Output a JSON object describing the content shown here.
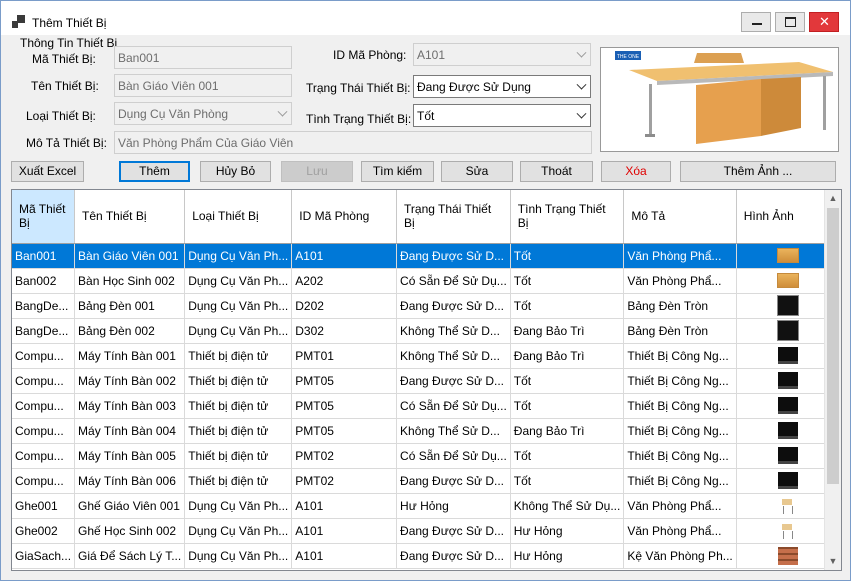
{
  "window": {
    "title": "Thêm Thiết Bị",
    "minimize": "—",
    "maximize": "▢",
    "close": "✕"
  },
  "form": {
    "group_title": "Thông Tin Thiết Bị",
    "ma_thiet_bi": {
      "label": "Mã Thiết Bị:",
      "value": "Ban001"
    },
    "ten_thiet_bi": {
      "label": "Tên Thiết Bị:",
      "value": "Bàn Giáo Viên 001"
    },
    "loai_thiet_bi": {
      "label": "Loại Thiết Bị:",
      "value": "Dụng Cụ Văn Phòng"
    },
    "mo_ta": {
      "label": "Mô Tả Thiết Bị:",
      "value": "Văn Phòng Phẩm Của Giáo Viên"
    },
    "id_phong": {
      "label": "ID Mã Phòng:",
      "value": "A101"
    },
    "trang_thai": {
      "label": "Trạng Thái Thiết Bị:",
      "value": "Đang Được Sử Dụng"
    },
    "tinh_trang": {
      "label": "Tình Trạng Thiết Bị:",
      "value": "Tốt"
    },
    "picture_logo": "THE ONE"
  },
  "buttons": {
    "export": "Xuất Excel",
    "add": "Thêm",
    "cancel": "Hủy Bỏ",
    "save": "Lưu",
    "search": "Tìm kiếm",
    "edit": "Sửa",
    "exit": "Thoát",
    "delete": "Xóa",
    "add_image": "Thêm Ảnh ..."
  },
  "grid": {
    "headers": [
      "Mã Thiết Bị",
      "Tên Thiết Bị",
      "Loại Thiết Bị",
      "ID Mã Phòng",
      "Trạng Thái Thiết Bị",
      "Tình Trạng Thiết Bị",
      "Mô Tả",
      "Hình Ảnh"
    ],
    "rows": [
      {
        "c": [
          "Ban001",
          "Bàn Giáo Viên 001",
          "Dụng Cụ Văn Ph...",
          "A101",
          "Đang Được Sử D...",
          "Tốt",
          "Văn Phòng Phẩ..."
        ],
        "img": "desk-image"
      },
      {
        "c": [
          "Ban002",
          "Bàn Học Sinh 002",
          "Dụng Cụ Văn Ph...",
          "A202",
          "Có Sẵn Để Sử Dụ...",
          "Tốt",
          "Văn Phòng Phẩ..."
        ],
        "img": "desk-image"
      },
      {
        "c": [
          "BangDe...",
          "Bảng Đèn 001",
          "Dụng Cụ Văn Ph...",
          "D202",
          "Đang Được Sử D...",
          "Tốt",
          "Bảng Đèn Tròn"
        ],
        "img": "light-board-image"
      },
      {
        "c": [
          "BangDe...",
          "Bảng Đèn 002",
          "Dụng Cụ Văn Ph...",
          "D302",
          "Không Thể Sử D...",
          "Đang Bảo Trì",
          "Bảng Đèn Tròn"
        ],
        "img": "light-board-image"
      },
      {
        "c": [
          "Compu...",
          "Máy Tính Bàn 001",
          "Thiết bị điện tử",
          "PMT01",
          "Không Thể Sử D...",
          "Đang Bảo Trì",
          "Thiết Bị Công Ng..."
        ],
        "img": "computer-image"
      },
      {
        "c": [
          "Compu...",
          "Máy Tính Bàn 002",
          "Thiết bị điện tử",
          "PMT05",
          "Đang Được Sử D...",
          "Tốt",
          "Thiết Bị Công Ng..."
        ],
        "img": "computer-image"
      },
      {
        "c": [
          "Compu...",
          "Máy Tính Bàn 003",
          "Thiết bị điện tử",
          "PMT05",
          "Có Sẵn Để Sử Dụ...",
          "Tốt",
          "Thiết Bị Công Ng..."
        ],
        "img": "computer-image"
      },
      {
        "c": [
          "Compu...",
          "Máy Tính Bàn 004",
          "Thiết bị điện tử",
          "PMT05",
          "Không Thể Sử D...",
          "Đang Bảo Trì",
          "Thiết Bị Công Ng..."
        ],
        "img": "computer-image"
      },
      {
        "c": [
          "Compu...",
          "Máy Tính Bàn 005",
          "Thiết bị điện tử",
          "PMT02",
          "Có Sẵn Để Sử Dụ...",
          "Tốt",
          "Thiết Bị Công Ng..."
        ],
        "img": "computer-image"
      },
      {
        "c": [
          "Compu...",
          "Máy Tính Bàn 006",
          "Thiết bị điện tử",
          "PMT02",
          "Đang Được Sử D...",
          "Tốt",
          "Thiết Bị Công Ng..."
        ],
        "img": "computer-image"
      },
      {
        "c": [
          "Ghe001",
          "Ghế Giáo Viên 001",
          "Dụng Cụ Văn Ph...",
          "A101",
          "Hư Hỏng",
          "Không Thể Sử Dụ...",
          "Văn Phòng Phẩ..."
        ],
        "img": "chair-image"
      },
      {
        "c": [
          "Ghe002",
          "Ghế Học Sinh 002",
          "Dụng Cụ Văn Ph...",
          "A101",
          "Đang Được Sử D...",
          "Hư Hỏng",
          "Văn Phòng Phẩ..."
        ],
        "img": "chair-image"
      },
      {
        "c": [
          "GiaSach...",
          "Giá Để Sách Lý T...",
          "Dụng Cụ Văn Ph...",
          "A101",
          "Đang Được Sử D...",
          "Hư Hỏng",
          "Kệ Văn Phòng Ph..."
        ],
        "img": "bookshelf-image"
      }
    ],
    "selected_row": 0
  },
  "colors": {
    "selection": "#0078d7",
    "header_selected": "#cce8ff",
    "close_button": "#e2383b",
    "delete_text": "#e00000"
  }
}
